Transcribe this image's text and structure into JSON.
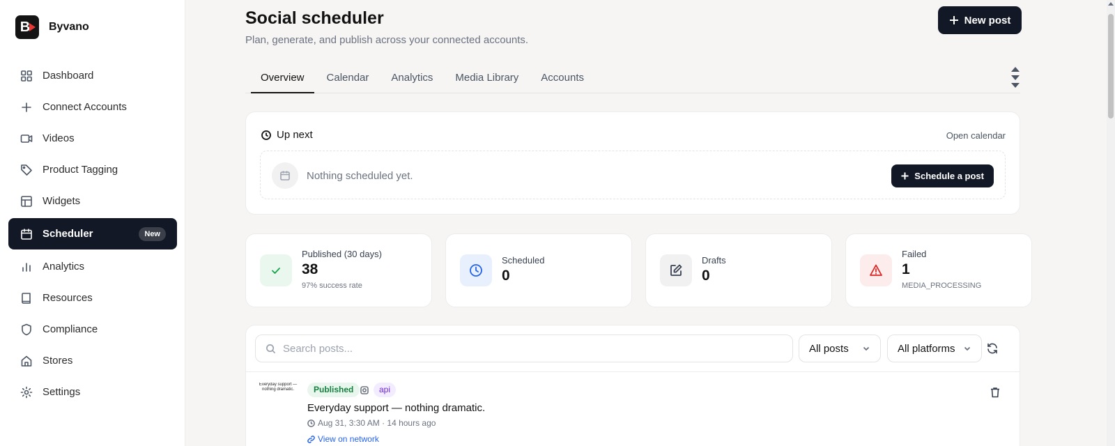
{
  "brand": {
    "name": "Byvano",
    "logo_letter": "B"
  },
  "sidebar": {
    "items": [
      {
        "label": "Dashboard",
        "icon": "grid-icon"
      },
      {
        "label": "Connect Accounts",
        "icon": "plus-icon"
      },
      {
        "label": "Videos",
        "icon": "video-icon"
      },
      {
        "label": "Product Tagging",
        "icon": "tag-icon"
      },
      {
        "label": "Widgets",
        "icon": "layout-icon"
      },
      {
        "label": "Scheduler",
        "icon": "calendar-icon",
        "badge": "New",
        "active": true
      },
      {
        "label": "Analytics",
        "icon": "bar-chart-icon"
      },
      {
        "label": "Resources",
        "icon": "book-icon"
      },
      {
        "label": "Compliance",
        "icon": "shield-icon"
      },
      {
        "label": "Stores",
        "icon": "store-icon"
      },
      {
        "label": "Settings",
        "icon": "gear-icon"
      }
    ]
  },
  "header": {
    "title": "Social scheduler",
    "subtitle": "Plan, generate, and publish across your connected accounts.",
    "new_post_label": "New post"
  },
  "tabs": [
    {
      "label": "Overview",
      "active": true
    },
    {
      "label": "Calendar"
    },
    {
      "label": "Analytics"
    },
    {
      "label": "Media Library"
    },
    {
      "label": "Accounts"
    }
  ],
  "up_next": {
    "title": "Up next",
    "open_calendar": "Open calendar",
    "empty_text": "Nothing scheduled yet.",
    "schedule_label": "Schedule a post"
  },
  "stats": [
    {
      "label": "Published (30 days)",
      "value": "38",
      "sub": "97% success rate",
      "icon": "check-icon",
      "color": "#16a34a",
      "bg": "#e9f7ef"
    },
    {
      "label": "Scheduled",
      "value": "0",
      "sub": "",
      "icon": "clock-icon",
      "color": "#2563eb",
      "bg": "#e8f0fe"
    },
    {
      "label": "Drafts",
      "value": "0",
      "sub": "",
      "icon": "edit-icon",
      "color": "#374151",
      "bg": "#f1f1f1"
    },
    {
      "label": "Failed",
      "value": "1",
      "sub": "MEDIA_PROCESSING",
      "icon": "alert-icon",
      "color": "#dc2626",
      "bg": "#fdecec"
    }
  ],
  "posts": {
    "search_placeholder": "Search posts...",
    "filter_status": "All posts",
    "filter_platform": "All platforms",
    "items": [
      {
        "thumb_text": "Everyday support — nothing dramatic.",
        "status": "Published",
        "source": "api",
        "text": "Everyday support — nothing dramatic.",
        "time": "Aug 31, 3:30 AM · 14 hours ago",
        "link": "View on network"
      }
    ]
  },
  "colors": {
    "accent": "#121826",
    "brand_red": "#e53935",
    "page_bg": "#f6f5f3"
  }
}
